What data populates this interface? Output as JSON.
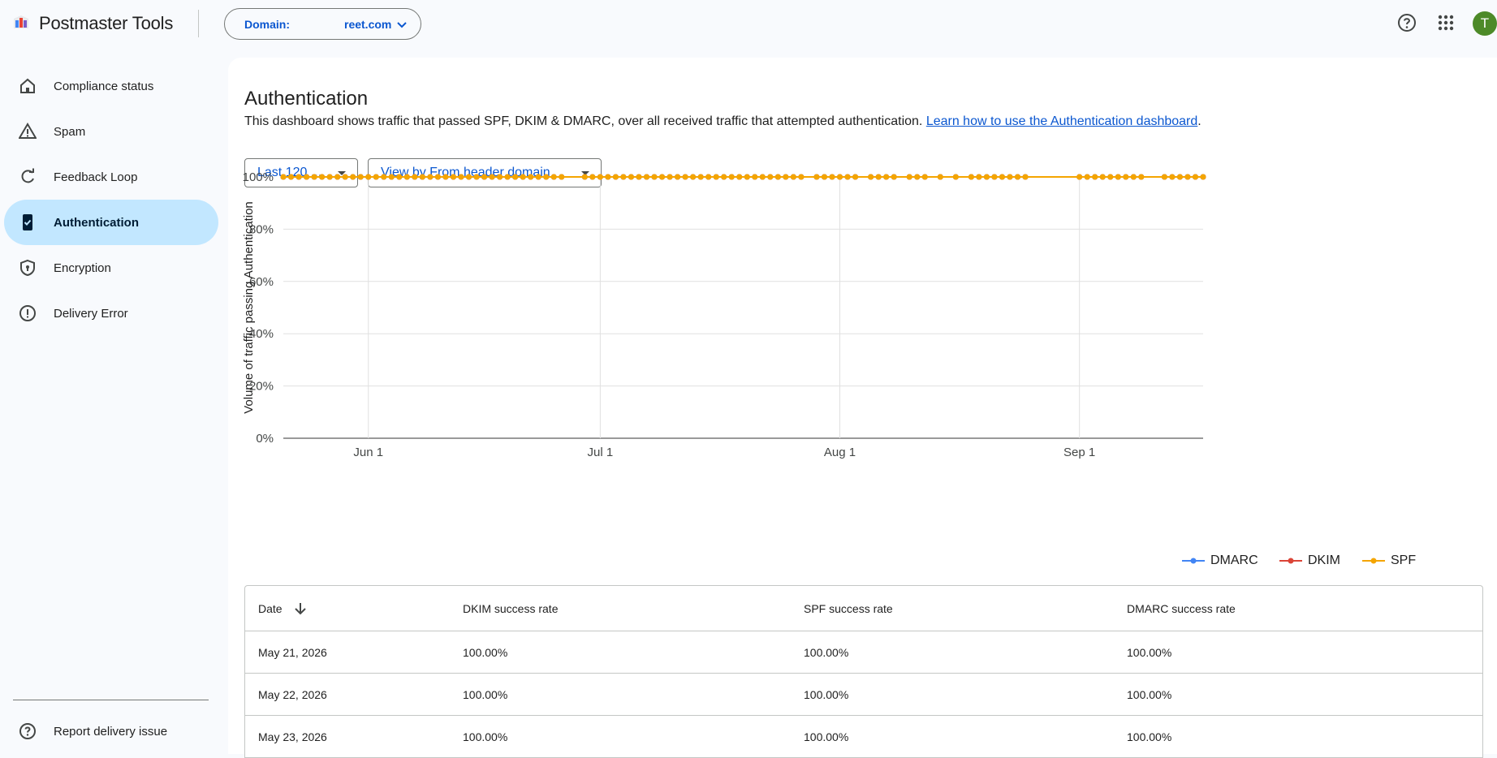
{
  "app": {
    "title": "Postmaster Tools",
    "domain_label": "Domain:",
    "domain_value": "reet.com",
    "avatar_initial": "T",
    "avatar_color": "#4d8a28"
  },
  "sidebar": {
    "items": [
      {
        "label": "Compliance status",
        "icon": "home-icon"
      },
      {
        "label": "Spam",
        "icon": "warning-icon"
      },
      {
        "label": "Feedback Loop",
        "icon": "refresh-icon"
      },
      {
        "label": "Authentication",
        "icon": "phone-check-icon",
        "active": true
      },
      {
        "label": "Encryption",
        "icon": "shield-icon"
      },
      {
        "label": "Delivery Error",
        "icon": "error-icon"
      }
    ],
    "footer_item": {
      "label": "Report delivery issue",
      "icon": "help-icon"
    }
  },
  "page": {
    "title": "Authentication",
    "description": "This dashboard shows traffic that passed SPF, DKIM & DMARC, over all received traffic that attempted authentication. ",
    "link_text": "Learn how to use the Authentication dashboard",
    "description_end": ".",
    "range_select": "Last 120 ...",
    "view_select": "View by From header domain"
  },
  "chart_data": {
    "type": "line",
    "ylabel": "Volume of traffic passing Authentication",
    "xlabel": "",
    "ylim": [
      0,
      100
    ],
    "y_ticks": [
      "0%",
      "20%",
      "40%",
      "60%",
      "80%",
      "100%"
    ],
    "x_ticks": [
      "Jun 1",
      "Jul 1",
      "Aug 1",
      "Sep 1"
    ],
    "x_range": [
      "2026-05-21",
      "2026-09-17"
    ],
    "legend": [
      "DMARC",
      "DKIM",
      "SPF"
    ],
    "legend_position": "bottom-right",
    "colors": {
      "DMARC": "#4285f4",
      "DKIM": "#db4437",
      "SPF": "#f4a500"
    },
    "missing_dates": [
      "2026-06-27",
      "2026-06-28",
      "2026-07-28",
      "2026-08-04",
      "2026-08-09",
      "2026-08-13",
      "2026-08-15",
      "2026-08-17",
      "2026-08-26",
      "2026-08-27",
      "2026-08-28",
      "2026-08-29",
      "2026-08-30",
      "2026-08-31",
      "2026-09-10",
      "2026-09-11"
    ],
    "series": [
      {
        "name": "DMARC",
        "value": 100
      },
      {
        "name": "DKIM",
        "value": 100
      },
      {
        "name": "SPF",
        "value": 100
      }
    ]
  },
  "table": {
    "headers": [
      "Date",
      "DKIM success rate",
      "SPF success rate",
      "DMARC success rate"
    ],
    "rows": [
      [
        "May 21, 2026",
        "100.00%",
        "100.00%",
        "100.00%"
      ],
      [
        "May 22, 2026",
        "100.00%",
        "100.00%",
        "100.00%"
      ],
      [
        "May 23, 2026",
        "100.00%",
        "100.00%",
        "100.00%"
      ]
    ]
  }
}
